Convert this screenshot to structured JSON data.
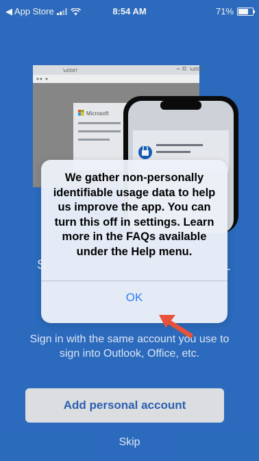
{
  "status_bar": {
    "back_label": "◀ App Store",
    "time": "8:54 AM",
    "battery": "71%",
    "battery_level": 0.71
  },
  "illustration": {
    "card_brand": "Microsoft"
  },
  "background": {
    "heading_fragment": "S",
    "sign_in_hint": "Sign in with the same account you use to sign into Outlook, Office, etc.",
    "add_account_label": "Add personal account",
    "skip_label": "Skip"
  },
  "alert": {
    "message": "We gather non-personally identifiable usage data to help us improve the app. You can turn this off in settings. Learn more in the FAQs available under the Help menu.",
    "ok_label": "OK"
  },
  "colors": {
    "background": "#2d6fc4",
    "alert_button": "#2f7bf6",
    "arrow": "#e8513a"
  }
}
